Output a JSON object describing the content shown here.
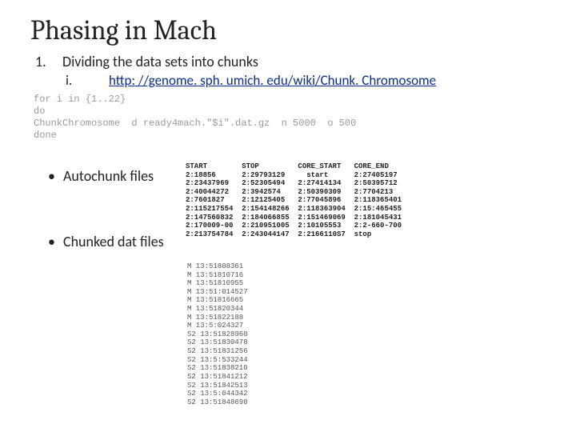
{
  "title": "Phasing in Mach",
  "step1_num": "1.",
  "step1_text": "Dividing the data sets into chunks",
  "step1i_num": "i.",
  "step1i_link": "http: //genome. sph. umich. edu/wiki/Chunk. Chromosome",
  "code": "for i in {1..22}\ndo\nChunkChromosome  d ready4mach.\"$i\".dat.gz  n 5000  o 500\ndone",
  "bullet_autochunk": "Autochunk files",
  "bullet_chunked": "Chunked dat files",
  "autochunk_table": "START        STOP         CORE_START   CORE_END\n2:18856      2:29793129     start      2:27405197\n2:23437969   2:52305494   2:27414134   2:50395712\n2:40044272   2:3942574    2:50390309   2:7704213\n2:7601827    2:12125405   2:77045896   2:118365401\n2:115217554  2:154148266  2:118363904  2:15:465455\n2:147560832  2:184066855  2:151469069  2:181045431\n2:170009-00  2:210951005  2:10105553   2:2-660-700\n2:213754784  2:243044147  2:2166110S7  stop",
  "chunked_list": "M 13:51808361\nM 13:51810716\nM 13:51810955\nM 13:51:014527\nM 13:51816665\nM 13:51820344\nM 13:51822188\nM 13:5:024327\nS2 13:51828960\nS2 13:51830478\nS2 13:51831256\nS2 13:5:533244\nS2 13:51838210\nS2 13:51841212\nS2 13:51842513\nS2 13:5:044342\nS2 13:51848690"
}
